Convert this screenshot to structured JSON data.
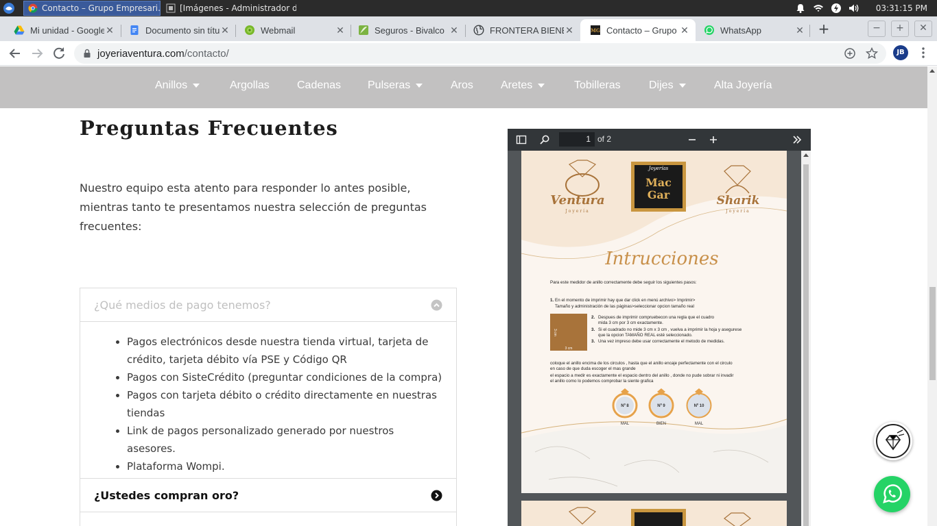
{
  "taskbar": {
    "windows": [
      {
        "label": "Contacto – Grupo Empresari...",
        "active": true
      },
      {
        "label": "[Imágenes - Administrador d...",
        "active": false
      }
    ],
    "clock": "03:31:15 PM"
  },
  "browser": {
    "tabs": [
      {
        "title": "Mi unidad - Google",
        "icon": "google-drive-icon"
      },
      {
        "title": "Documento sin títu",
        "icon": "google-docs-icon"
      },
      {
        "title": "Webmail",
        "icon": "webmail-icon"
      },
      {
        "title": "Seguros - Bivalco",
        "icon": "bivalco-icon"
      },
      {
        "title": "FRONTERA BIENES",
        "icon": "globe-icon"
      },
      {
        "title": "Contacto – Grupo E",
        "icon": "jewelry-logo-icon",
        "active": true
      },
      {
        "title": "WhatsApp",
        "icon": "whatsapp-icon"
      }
    ],
    "url_host": "joyeriaventura.com",
    "url_path": "/contacto/",
    "profile_initials": "JB"
  },
  "site_nav": {
    "items": [
      {
        "label": "Anillos",
        "has_dropdown": true
      },
      {
        "label": "Argollas",
        "has_dropdown": false
      },
      {
        "label": "Cadenas",
        "has_dropdown": false
      },
      {
        "label": "Pulseras",
        "has_dropdown": true
      },
      {
        "label": "Aros",
        "has_dropdown": false
      },
      {
        "label": "Aretes",
        "has_dropdown": true
      },
      {
        "label": "Tobilleras",
        "has_dropdown": false
      },
      {
        "label": "Dijes",
        "has_dropdown": true
      },
      {
        "label": "Alta Joyería",
        "has_dropdown": false
      }
    ]
  },
  "faq": {
    "title": "Preguntas Frecuentes",
    "intro": "Nuestro equipo esta atento para responder lo antes posible, mientras tanto te presentamos nuestra selección de preguntas frecuentes:",
    "items": [
      {
        "question": "¿Qué medios de pago tenemos?",
        "open": true,
        "answers": [
          "Pagos electrónicos desde nuestra tienda virtual, tarjeta de crédito, tarjeta débito vía PSE y Código QR",
          "Pagos con SisteCrédito (preguntar condiciones de la compra)",
          "Pagos con tarjeta débito o crédito directamente en nuestras tiendas",
          "Link de pagos personalizado generado por nuestros asesores.",
          "Plataforma Wompi."
        ]
      },
      {
        "question": "¿Ustedes compran oro?",
        "open": false
      }
    ]
  },
  "pdf_viewer": {
    "page_current": "1",
    "page_total_label": "of 2",
    "document": {
      "brand_left": "Ventura",
      "brand_left_sub": "Joyería",
      "brand_center_top": "Joyerías",
      "brand_center_line1": "Mac",
      "brand_center_line2": "Gar",
      "brand_right": "Sharik",
      "brand_right_sub": "Joyería",
      "heading": "Intrucciones",
      "lead": "Para este medidor de anillo correctamente debe seguir los siguientes pasos:",
      "step1_a": "En el momento de imprimir hay que dar click en  menú archivo> Imprimir>",
      "step1_b": "Tamaño y administración de las páginas>seleccionar  opcion tamaño real",
      "step2_a": "Despues de imprimir compruebecon una regla que el cuadro",
      "step2_b": "mida 3 cm por 3 cm exactamente.",
      "step3_a": "Si el cuadrado no mide 3 cm x 3 cm , vuelva a imprimir la hoja y asegurese",
      "step3_b": "que la opcion TAMAÑO REAL esté seleccionado.",
      "step4": "Una vez impreso debe usar correctamente el metodo de medidas.",
      "square_label_h": "3 cm",
      "square_label_v": "3 cm",
      "para_1": "coloque el anillo encima de los circulos , hasta que el anillo encaje perfectamente  con el circulo",
      "para_2": "en caso de que duda escoger el mas grande",
      "para_3": "el espacio a medir es exactamente el espacio dentro del anillo , donde no pude sobrar  ni invadir",
      "para_4": "el anillo como lo podemos comprobar la siente grafica",
      "rings": [
        {
          "num": "Nº 8",
          "verdict": "MAL"
        },
        {
          "num": "Nº 9",
          "verdict": "BIEN"
        },
        {
          "num": "Nº 10",
          "verdict": "MAL"
        }
      ]
    }
  },
  "colors": {
    "nav_bg": "#c2c1c1",
    "gold": "#b07a3c",
    "whatsapp": "#25d366",
    "taskbar_active": "#3a5a9a"
  }
}
